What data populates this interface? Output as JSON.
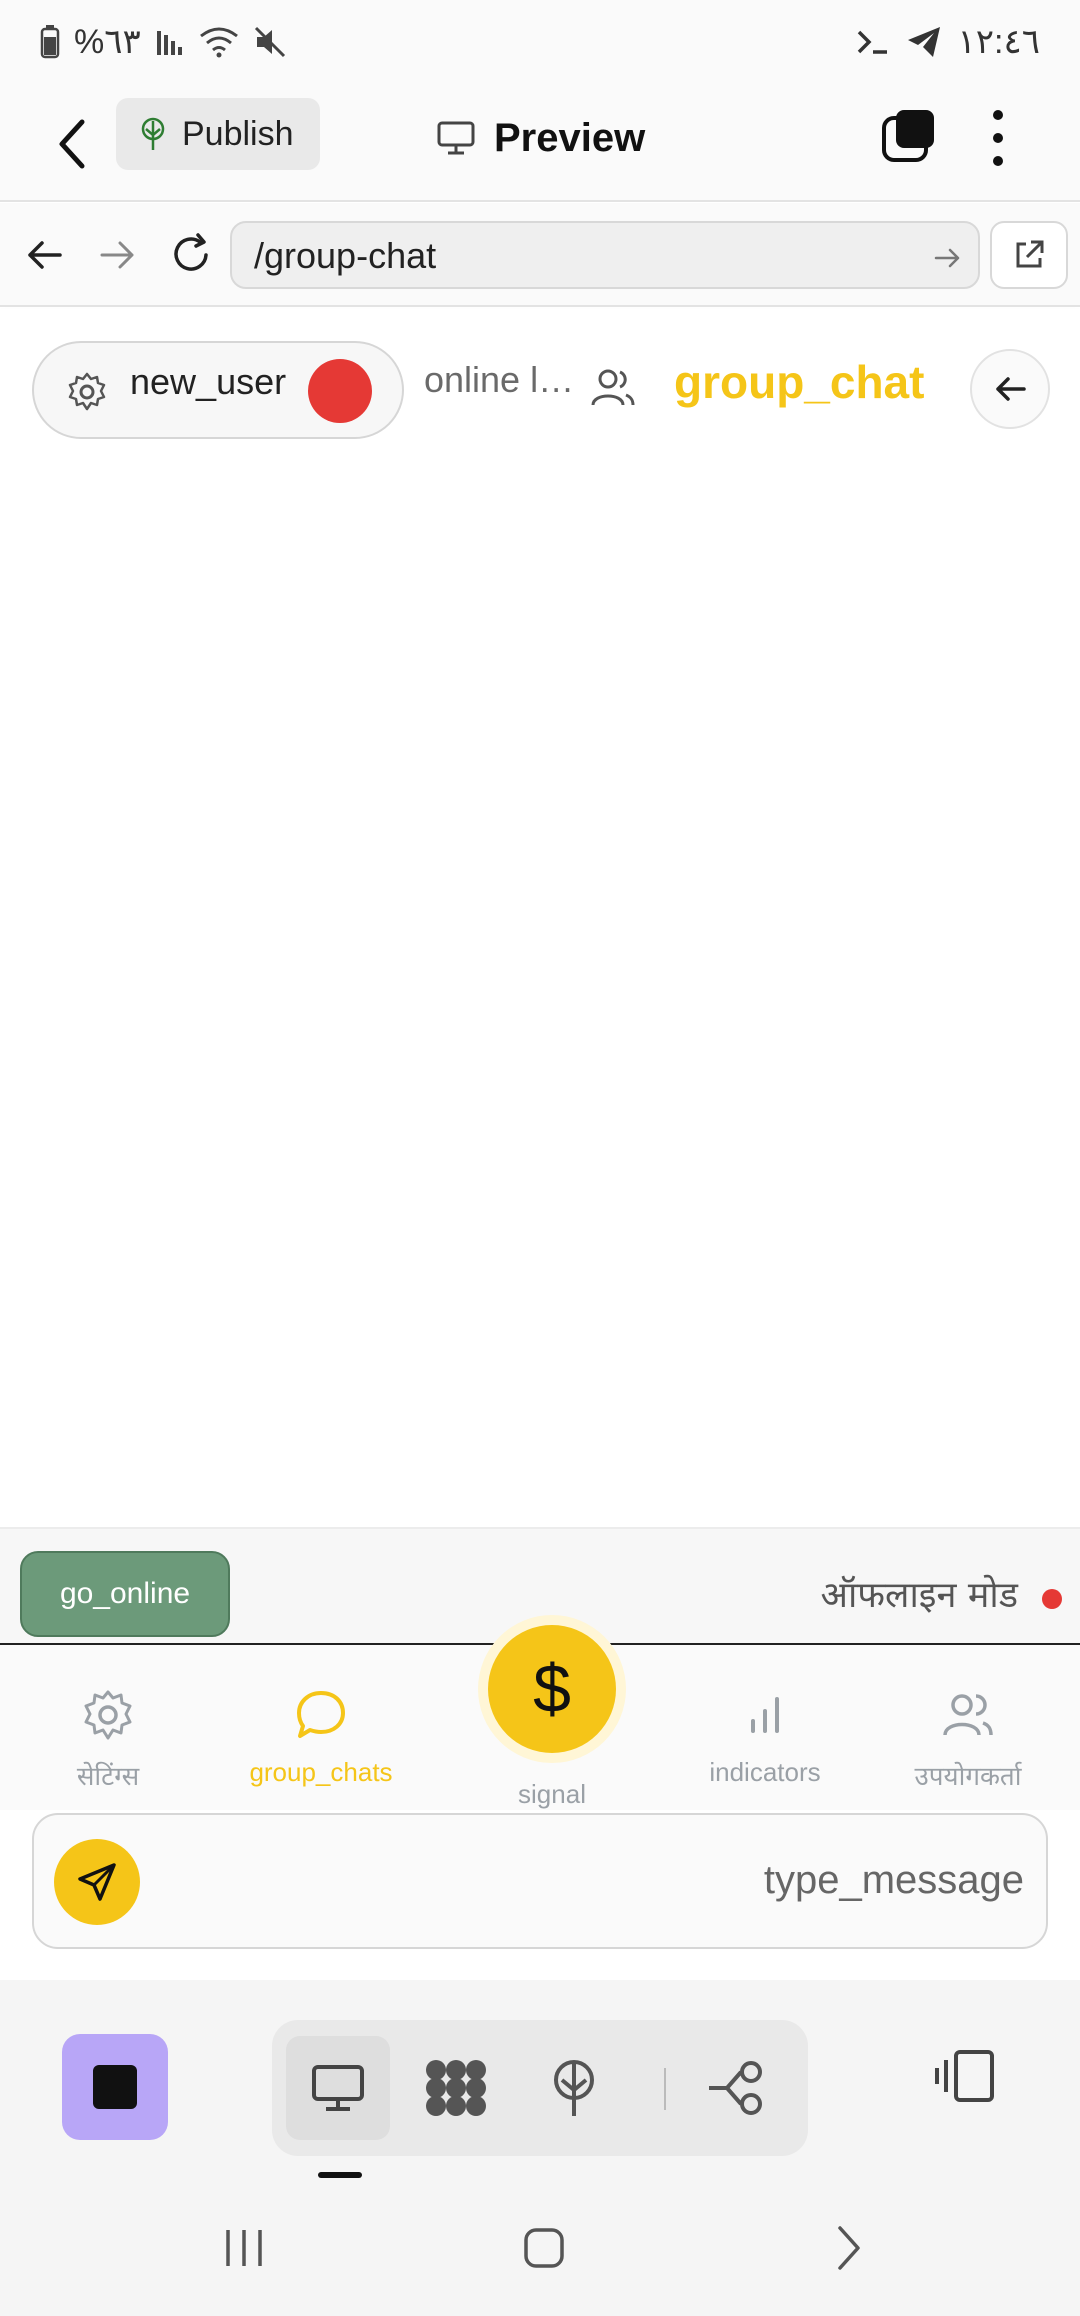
{
  "status_bar": {
    "battery_percent": "%٦٣",
    "time": "١٢:٤٦"
  },
  "app_toolbar": {
    "publish_label": "Publish",
    "preview_label": "Preview"
  },
  "url_bar": {
    "url": "/group-chat"
  },
  "chat_header": {
    "username": "new_user",
    "online_label": "online l…",
    "title": "group_chat"
  },
  "offline_bar": {
    "go_online_label": "go_online",
    "offline_mode_label": "ऑफलाइन मोड"
  },
  "bottom_nav": {
    "items": [
      {
        "label": "सेटिंग्स",
        "icon": "gear-icon",
        "active": false
      },
      {
        "label": "group_chats",
        "icon": "chat-bubble-icon",
        "active": true
      },
      {
        "label": "signal",
        "icon": "dollar-icon",
        "active": false
      },
      {
        "label": "indicators",
        "icon": "bar-chart-icon",
        "active": false
      },
      {
        "label": "उपयोगकर्ता",
        "icon": "users-icon",
        "active": false
      }
    ]
  },
  "compose": {
    "placeholder": "type_message"
  },
  "colors": {
    "accent": "#f5c518",
    "status_red": "#e53935",
    "go_online_green": "#6c9a7a",
    "stop_button_purple": "#b8a6f7"
  }
}
